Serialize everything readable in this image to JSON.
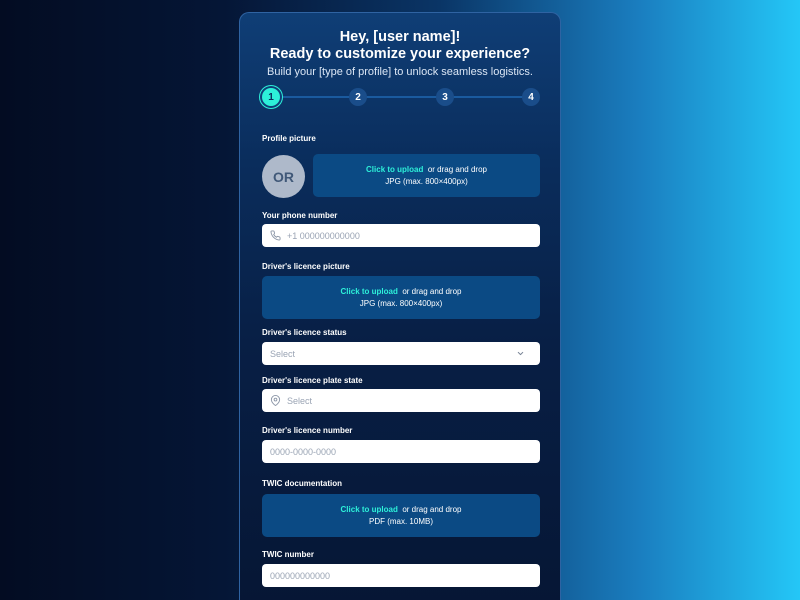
{
  "header": {
    "greeting": "Hey, [user name]!",
    "headline": "Ready to customize your experience?",
    "subtitle": "Build your [type of profile] to unlock seamless logistics."
  },
  "stepper": {
    "steps": [
      "1",
      "2",
      "3",
      "4"
    ],
    "active_step": "1"
  },
  "profile_picture": {
    "label": "Profile picture",
    "avatar_text": "OR",
    "upload_link": "Click to upload",
    "upload_rest": "or drag and drop",
    "upload_hint": "JPG (max. 800×400px)"
  },
  "phone": {
    "label": "Your phone number",
    "placeholder": "+1 000000000000",
    "icon": "phone-icon"
  },
  "licence_picture": {
    "label": "Driver's licence picture",
    "upload_link": "Click to upload",
    "upload_rest": "or drag and drop",
    "upload_hint": "JPG (max. 800×400px)"
  },
  "licence_status": {
    "label": "Driver's licence status",
    "placeholder": "Select",
    "icon": "chevron-down-icon"
  },
  "plate_state": {
    "label": "Driver's licence plate state",
    "placeholder": "Select",
    "icon": "location-pin-icon"
  },
  "licence_number": {
    "label": "Driver's licence number",
    "placeholder": "0000-0000-0000"
  },
  "twic_doc": {
    "label": "TWIC documentation",
    "upload_link": "Click to upload",
    "upload_rest": "or drag and drop",
    "upload_hint": "PDF (max. 10MB)"
  },
  "twic_number": {
    "label": "TWIC number",
    "placeholder": "000000000000"
  },
  "colors": {
    "accent": "#2df0d9",
    "upload_bg": "#0b4a84",
    "card_top": "#0f3e76",
    "card_bottom": "#061634"
  }
}
